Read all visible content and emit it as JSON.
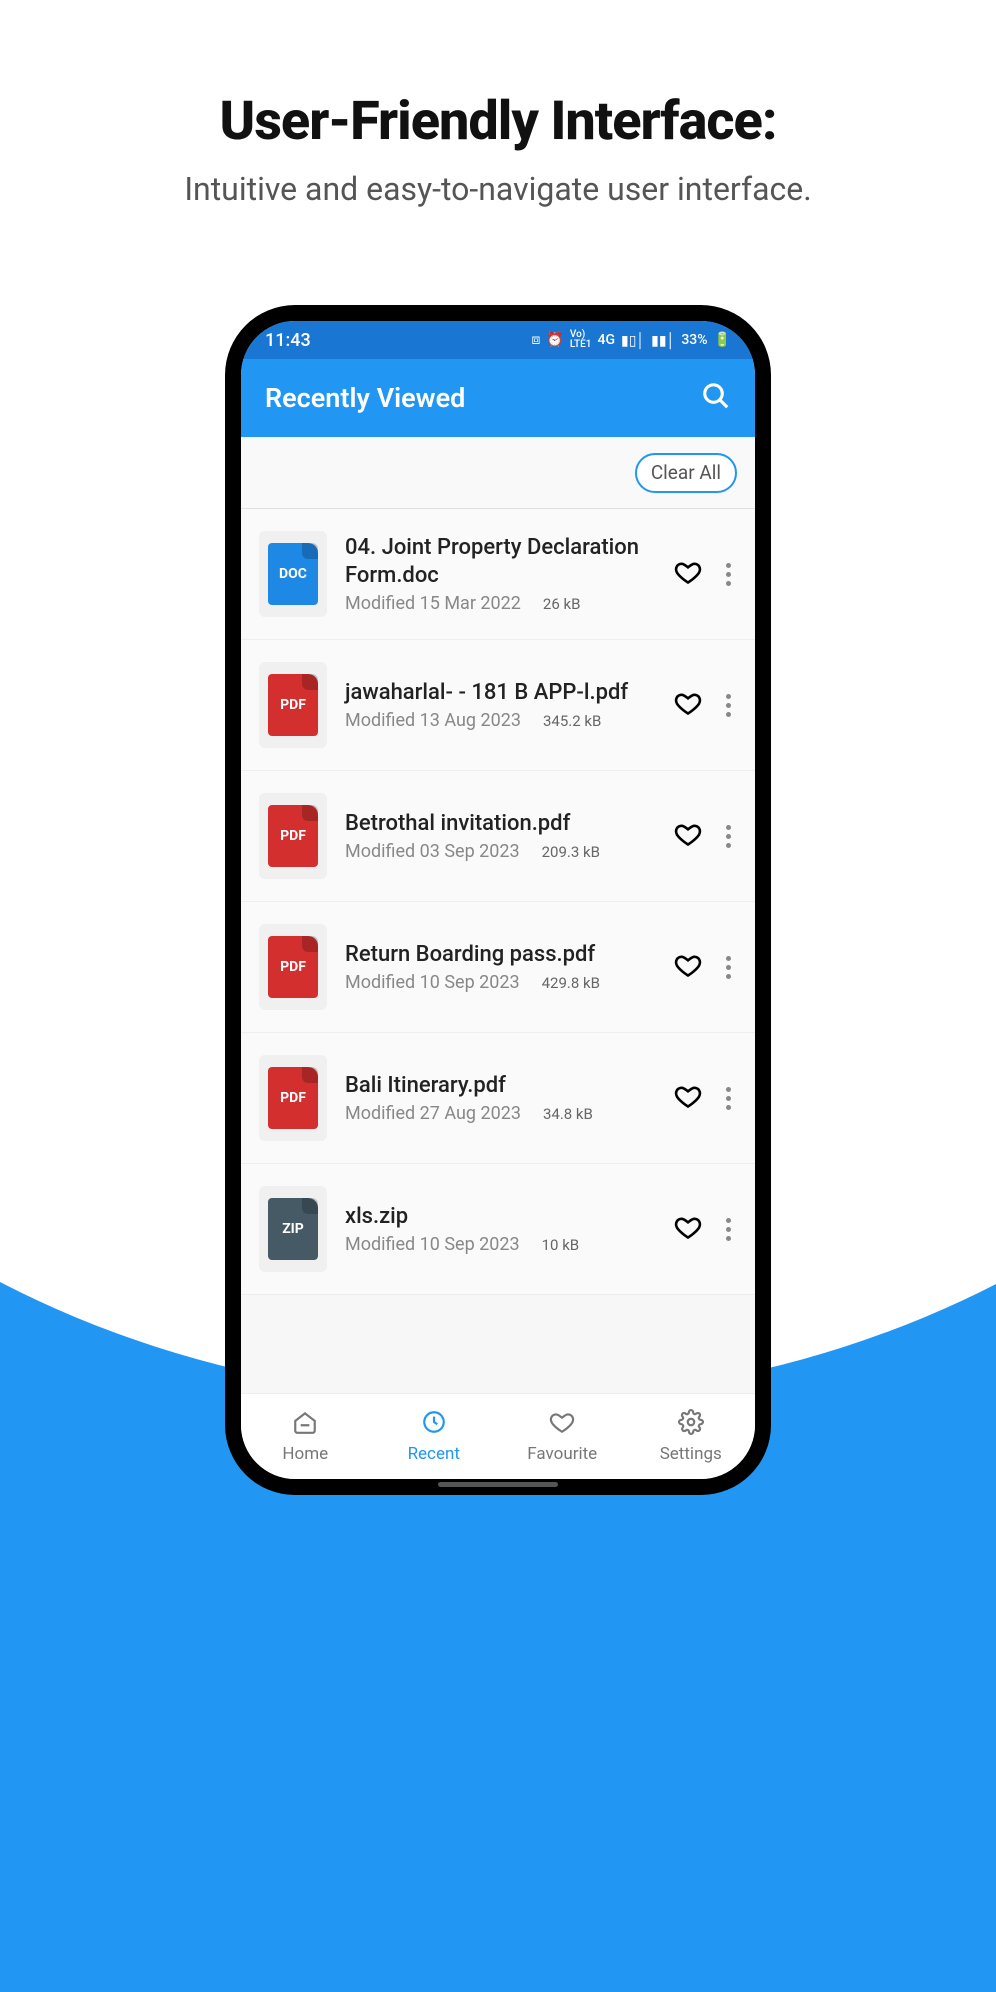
{
  "marketing": {
    "title": "User-Friendly Interface:",
    "subtitle": "Intuitive and easy-to-navigate user interface."
  },
  "status": {
    "time": "11:43",
    "net": "4G",
    "lte": "LTE1",
    "battery": "33%"
  },
  "header": {
    "title": "Recently Viewed",
    "clear_label": "Clear All"
  },
  "files": [
    {
      "type": "DOC",
      "name": "04. Joint Property Declaration Form.doc",
      "modified": "Modified 15 Mar 2022",
      "size": "26 kB"
    },
    {
      "type": "PDF",
      "name": "jawaharlal- - 181  B APP-l.pdf",
      "modified": "Modified 13 Aug 2023",
      "size": "345.2 kB"
    },
    {
      "type": "PDF",
      "name": "Betrothal invitation.pdf",
      "modified": "Modified 03 Sep 2023",
      "size": "209.3 kB"
    },
    {
      "type": "PDF",
      "name": "Return Boarding pass.pdf",
      "modified": "Modified 10 Sep 2023",
      "size": "429.8 kB"
    },
    {
      "type": "PDF",
      "name": "Bali Itinerary.pdf",
      "modified": "Modified 27 Aug 2023",
      "size": "34.8 kB"
    },
    {
      "type": "ZIP",
      "name": "xls.zip",
      "modified": "Modified 10 Sep 2023",
      "size": "10 kB"
    }
  ],
  "nav": {
    "home": "Home",
    "recent": "Recent",
    "favourite": "Favourite",
    "settings": "Settings"
  }
}
